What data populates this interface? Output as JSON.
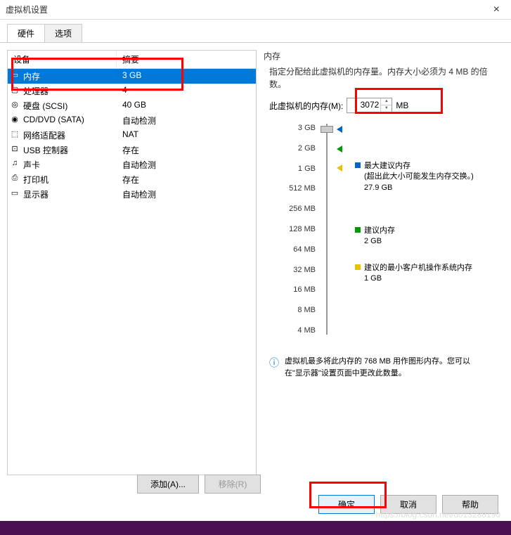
{
  "window": {
    "title": "虚拟机设置",
    "close": "×"
  },
  "tabs": {
    "hardware": "硬件",
    "options": "选项"
  },
  "columns": {
    "device": "设备",
    "summary": "摘要"
  },
  "devices": [
    {
      "icon": "▭",
      "name": "内存",
      "value": "3 GB",
      "selected": true
    },
    {
      "icon": "▢",
      "name": "处理器",
      "value": "4",
      "selected": false
    },
    {
      "icon": "◎",
      "name": "硬盘 (SCSI)",
      "value": "40 GB",
      "selected": false
    },
    {
      "icon": "◉",
      "name": "CD/DVD (SATA)",
      "value": "自动检测",
      "selected": false
    },
    {
      "icon": "⬚",
      "name": "网络适配器",
      "value": "NAT",
      "selected": false
    },
    {
      "icon": "⊡",
      "name": "USB 控制器",
      "value": "存在",
      "selected": false
    },
    {
      "icon": "♫",
      "name": "声卡",
      "value": "自动检测",
      "selected": false
    },
    {
      "icon": "⎙",
      "name": "打印机",
      "value": "存在",
      "selected": false
    },
    {
      "icon": "▭",
      "name": "显示器",
      "value": "自动检测",
      "selected": false
    }
  ],
  "memory": {
    "groupLabel": "内存",
    "description": "指定分配给此虚拟机的内存量。内存大小必须为 4 MB 的倍数。",
    "fieldLabel": "此虚拟机的内存(M):",
    "value": "3072",
    "unit": "MB",
    "ticks": [
      "3 GB",
      "2 GB",
      "1 GB",
      "512 MB",
      "256 MB",
      "128 MB",
      "64 MB",
      "32 MB",
      "16 MB",
      "8 MB",
      "4 MB"
    ],
    "max_label": "最大建议内存",
    "max_note": "(超出此大小可能发生内存交换。)",
    "max_value": "27.9 GB",
    "rec_label": "建议内存",
    "rec_value": "2 GB",
    "min_label": "建议的最小客户机操作系统内存",
    "min_value": "1 GB",
    "infoNote": "虚拟机最多将此内存的 768 MB 用作图形内存。您可以在\"显示器\"设置页面中更改此数量。"
  },
  "buttons": {
    "add": "添加(A)...",
    "remove": "移除(R)",
    "ok": "确定",
    "cancel": "取消",
    "help": "帮助"
  },
  "watermark": "https://blog.csdn.net/u013288190"
}
